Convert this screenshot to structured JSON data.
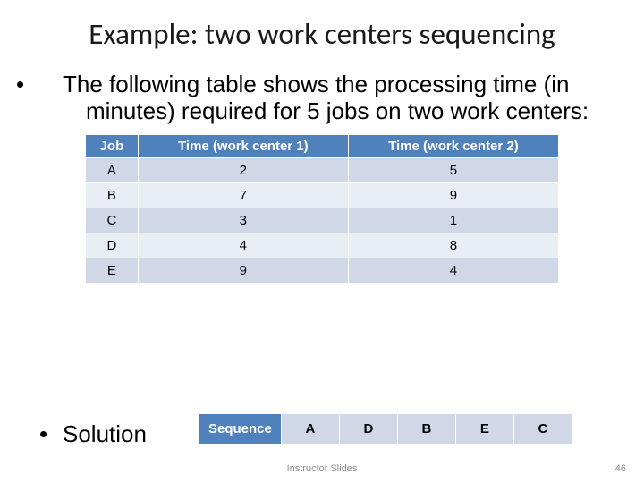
{
  "title": "Example: two work centers sequencing",
  "intro": "The following table shows the processing time (in minutes) required for 5 jobs on two work centers:",
  "table": {
    "headers": [
      "Job",
      "Time  (work center 1)",
      "Time  (work center  2)"
    ],
    "rows": [
      {
        "job": "A",
        "t1": "2",
        "t2": "5"
      },
      {
        "job": "B",
        "t1": "7",
        "t2": "9"
      },
      {
        "job": "C",
        "t1": "3",
        "t2": "1"
      },
      {
        "job": "D",
        "t1": "4",
        "t2": "8"
      },
      {
        "job": "E",
        "t1": "9",
        "t2": "4"
      }
    ]
  },
  "solution_label": "Solution",
  "sequence": {
    "header": "Sequence",
    "values": [
      "A",
      "D",
      "B",
      "E",
      "C"
    ]
  },
  "footer_center": "Instructor Slides",
  "footer_right": "46",
  "chart_data": {
    "type": "table",
    "title": "Processing times for 5 jobs on two work centers",
    "columns": [
      "Job",
      "Time (work center 1)",
      "Time (work center 2)"
    ],
    "rows": [
      [
        "A",
        2,
        5
      ],
      [
        "B",
        7,
        9
      ],
      [
        "C",
        3,
        1
      ],
      [
        "D",
        4,
        8
      ],
      [
        "E",
        9,
        4
      ]
    ],
    "sequence_solution": [
      "A",
      "D",
      "B",
      "E",
      "C"
    ]
  }
}
